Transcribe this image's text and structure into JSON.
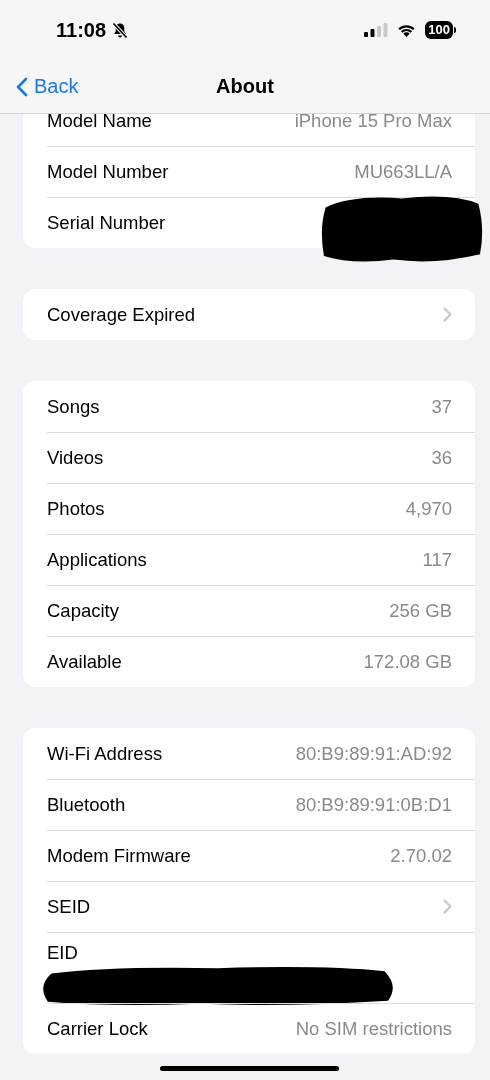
{
  "status_bar": {
    "time": "11:08",
    "battery": "100"
  },
  "nav": {
    "back": "Back",
    "title": "About"
  },
  "groups": [
    {
      "rows": [
        {
          "kind": "value",
          "label": "Model Name",
          "value": "iPhone 15 Pro Max"
        },
        {
          "kind": "value",
          "label": "Model Number",
          "value": "MU663LL/A"
        },
        {
          "kind": "value",
          "label": "Serial Number",
          "redacted": true
        }
      ]
    },
    {
      "rows": [
        {
          "kind": "link",
          "label": "Coverage Expired"
        }
      ]
    },
    {
      "rows": [
        {
          "kind": "value",
          "label": "Songs",
          "value": "37"
        },
        {
          "kind": "value",
          "label": "Videos",
          "value": "36"
        },
        {
          "kind": "value",
          "label": "Photos",
          "value": "4,970"
        },
        {
          "kind": "value",
          "label": "Applications",
          "value": "117"
        },
        {
          "kind": "value",
          "label": "Capacity",
          "value": "256 GB"
        },
        {
          "kind": "value",
          "label": "Available",
          "value": "172.08 GB"
        }
      ]
    },
    {
      "rows": [
        {
          "kind": "value",
          "label": "Wi-Fi Address",
          "value": "80:B9:89:91:AD:92"
        },
        {
          "kind": "value",
          "label": "Bluetooth",
          "value": "80:B9:89:91:0B:D1"
        },
        {
          "kind": "value",
          "label": "Modem Firmware",
          "value": "2.70.02"
        },
        {
          "kind": "link",
          "label": "SEID"
        },
        {
          "kind": "stacked",
          "label": "EID",
          "redacted": true
        },
        {
          "kind": "value",
          "label": "Carrier Lock",
          "value": "No SIM restrictions"
        }
      ]
    }
  ]
}
